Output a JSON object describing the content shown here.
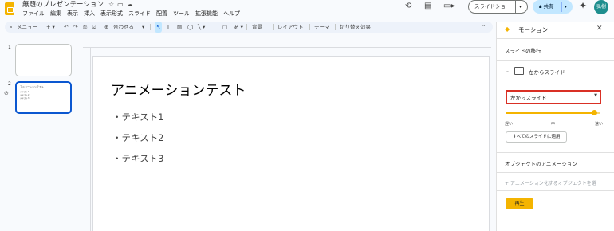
{
  "app": {
    "doc_title": "無題のプレゼンテーション",
    "menu": [
      "ファイル",
      "編集",
      "表示",
      "挿入",
      "表示形式",
      "スライド",
      "配置",
      "ツール",
      "拡張機能",
      "ヘルプ"
    ],
    "slideshow_label": "スライドショー",
    "share_label": "共有",
    "avatar_initials": "弘樹"
  },
  "toolbar": {
    "menu_label": "メニュー",
    "zoom_label": "合わせる",
    "background_label": "背景",
    "layout_label": "レイアウト",
    "theme_label": "テーマ",
    "transition_label": "切り替え効果"
  },
  "slides": [
    {
      "number": "1",
      "title": "",
      "lines": []
    },
    {
      "number": "2",
      "title": "アニメーションテスト",
      "lines": [
        "テキスト1",
        "テキスト2",
        "テキスト3"
      ]
    }
  ],
  "canvas": {
    "title": "アニメーションテスト",
    "bullets": [
      "・テキスト1",
      "・テキスト2",
      "・テキスト3"
    ]
  },
  "motion_panel": {
    "title": "モーション",
    "section_transition": "スライドの移行",
    "transition_name": "左からスライド",
    "dropdown_value": "左からスライド",
    "speed_slow": "遅い",
    "speed_mid": "中",
    "speed_fast": "速い",
    "speed_value_fraction": 0.95,
    "apply_all_label": "すべてのスライドに適用",
    "section_object": "オブジェクトのアニメーション",
    "add_animation_label": "アニメーション化するオブジェクトを選",
    "play_label": "再生"
  },
  "colors": {
    "accent_yellow": "#f4b400",
    "highlight_red": "#d93025",
    "selection_blue": "#0b57d0",
    "share_bg": "#c2e7ff"
  }
}
